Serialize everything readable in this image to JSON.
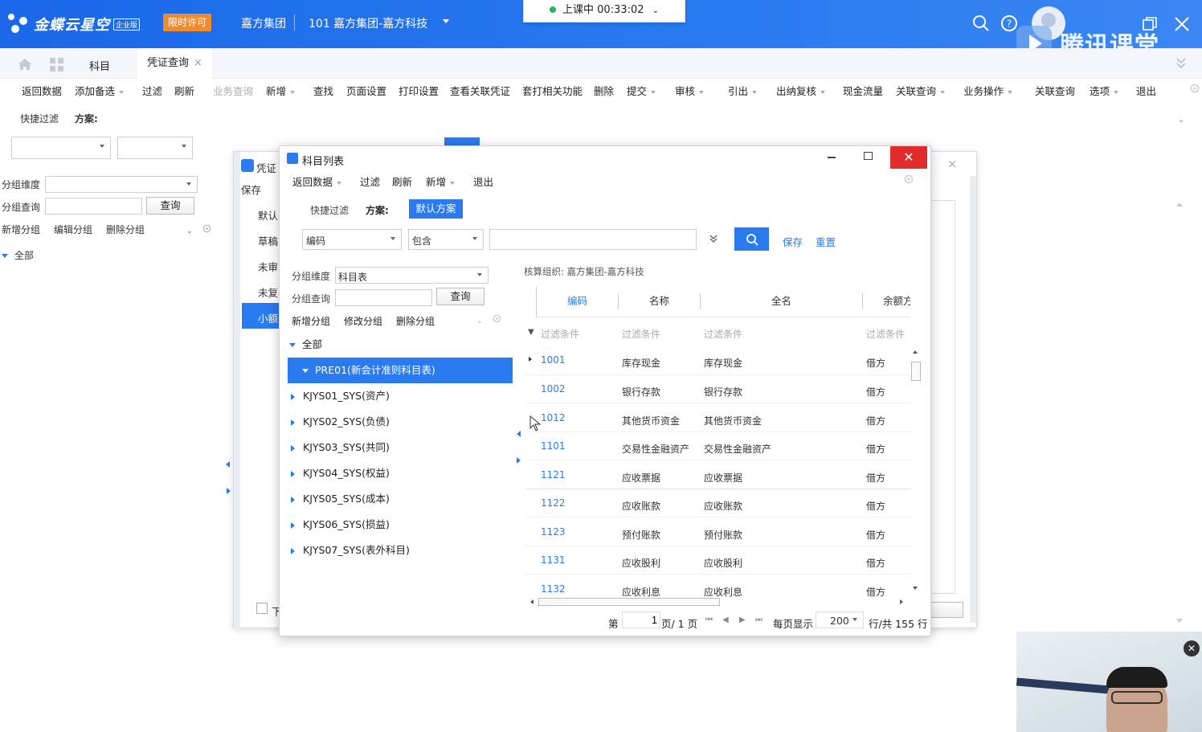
{
  "header": {
    "brand": "金蝶云星空",
    "brand_badge": "企业版",
    "trial_badge": "限时许可",
    "org_group": "嘉方集团",
    "org_code_name": "101  嘉方集团-嘉方科技",
    "class_timer": "上课中 00:33:02",
    "watermark": "腾讯课堂"
  },
  "tabs": [
    {
      "label": "科目"
    },
    {
      "label": "凭证查询"
    }
  ],
  "toolbar": [
    {
      "label": "返回数据",
      "dim": false
    },
    {
      "label": "添加备选",
      "dim": false
    },
    {
      "label": "过滤",
      "dim": false
    },
    {
      "label": "刷新",
      "dim": false
    },
    {
      "label": "业务查询",
      "dim": true
    },
    {
      "label": "新增",
      "dim": false
    },
    {
      "label": "查找",
      "dim": false
    },
    {
      "label": "页面设置",
      "dim": false
    },
    {
      "label": "打印设置",
      "dim": false
    },
    {
      "label": "查看关联凭证",
      "dim": false
    },
    {
      "label": "套打相关功能",
      "dim": false
    },
    {
      "label": "删除",
      "dim": false
    },
    {
      "label": "提交",
      "dim": false
    },
    {
      "label": "审核",
      "dim": false
    },
    {
      "label": "引出",
      "dim": false
    },
    {
      "label": "出纳复核",
      "dim": false
    },
    {
      "label": "现金流量",
      "dim": false
    },
    {
      "label": "关联查询",
      "dim": false
    },
    {
      "label": "业务操作",
      "dim": false
    },
    {
      "label": "关联查询",
      "dim": false
    },
    {
      "label": "选项",
      "dim": false
    },
    {
      "label": "退出",
      "dim": false
    }
  ],
  "left_panel": {
    "quick_filter": "快捷过滤",
    "scheme": "方案:",
    "group_dim_label": "分组维度",
    "group_query_label": "分组查询",
    "query_btn": "查询",
    "new_group": "新增分组",
    "edit_group": "编辑分组",
    "delete_group": "删除分组",
    "all": "全部"
  },
  "bg_dialog": {
    "title": "凭证",
    "save": "保存",
    "side": [
      "默认",
      "草稿",
      "未审",
      "未复",
      "小额"
    ],
    "checkbox_label": "下"
  },
  "dialog": {
    "title": "科目列表",
    "toolbar": [
      "返回数据",
      "过滤",
      "刷新",
      "新增",
      "退出"
    ],
    "quick_filter": "快捷过滤",
    "scheme_label": "方案:",
    "scheme_default": "默认方案",
    "field_select": "编码",
    "op_select": "包含",
    "search_value": "",
    "save_link": "保存",
    "reset_link": "重置",
    "group_dim_label": "分组维度",
    "group_dim_value": "科目表",
    "group_query_label": "分组查询",
    "query_btn": "查询",
    "new_group": "新增分组",
    "edit_group": "修改分组",
    "delete_group": "删除分组",
    "tree_all": "全部",
    "tree_items": [
      "PRE01(新会计准则科目表)",
      "KJYS01_SYS(资产)",
      "KJYS02_SYS(负债)",
      "KJYS03_SYS(共同)",
      "KJYS04_SYS(权益)",
      "KJYS05_SYS(成本)",
      "KJYS06_SYS(损益)",
      "KJYS07_SYS(表外科目)"
    ],
    "org_label": "核算组织: 嘉方集团-嘉方科技",
    "columns": [
      "编码",
      "名称",
      "全名",
      "余额方向"
    ],
    "filter_placeholder": "过滤条件",
    "rows": [
      {
        "code": "1001",
        "name": "库存现金",
        "full": "库存现金",
        "dir": "借方"
      },
      {
        "code": "1002",
        "name": "银行存款",
        "full": "银行存款",
        "dir": "借方"
      },
      {
        "code": "1012",
        "name": "其他货币资金",
        "full": "其他货币资金",
        "dir": "借方"
      },
      {
        "code": "1101",
        "name": "交易性金融资产",
        "full": "交易性金融资产",
        "dir": "借方"
      },
      {
        "code": "1121",
        "name": "应收票据",
        "full": "应收票据",
        "dir": "借方"
      },
      {
        "code": "1122",
        "name": "应收账款",
        "full": "应收账款",
        "dir": "借方"
      },
      {
        "code": "1123",
        "name": "预付账款",
        "full": "预付账款",
        "dir": "借方"
      },
      {
        "code": "1131",
        "name": "应收股利",
        "full": "应收股利",
        "dir": "借方"
      },
      {
        "code": "1132",
        "name": "应收利息",
        "full": "应收利息",
        "dir": "借方"
      }
    ],
    "pager": {
      "page_prefix": "第",
      "page_value": "1",
      "page_suffix": "页/ 1 页",
      "per_page_label": "每页显示",
      "per_page_value": "200",
      "total": "行/共 155 行"
    }
  },
  "colors": {
    "brand_blue": "#2a7af0",
    "header_blue": "#1a68e8",
    "trial_orange": "#f28b2c",
    "close_red": "#e22b2b"
  }
}
